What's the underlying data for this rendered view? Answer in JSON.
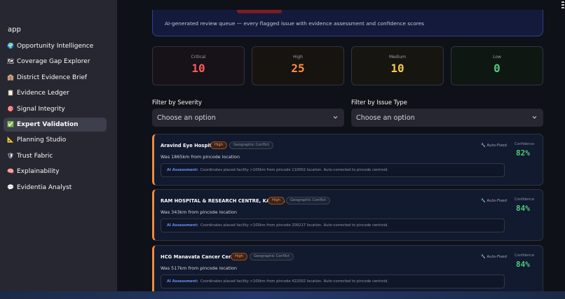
{
  "sidebar": {
    "app_label": "app",
    "items": [
      {
        "emoji": "🌍",
        "label": "Opportunity Intelligence",
        "active": false
      },
      {
        "emoji": "🗺",
        "label": "Coverage Gap Explorer",
        "active": false
      },
      {
        "emoji": "🏨",
        "label": "District Evidence Brief",
        "active": false
      },
      {
        "emoji": "📋",
        "label": "Evidence Ledger",
        "active": false
      },
      {
        "emoji": "🎯",
        "label": "Signal Integrity",
        "active": false
      },
      {
        "emoji": "✅",
        "label": "Expert Validation",
        "active": true
      },
      {
        "emoji": "📐",
        "label": "Planning Studio",
        "active": false
      },
      {
        "emoji": "🛡",
        "label": "Trust Fabric",
        "active": false
      },
      {
        "emoji": "🧠",
        "label": "Explainability",
        "active": false
      },
      {
        "emoji": "💬",
        "label": "Evidentia Analyst",
        "active": false
      }
    ]
  },
  "banner": {
    "text": "AI-generated review queue — every flagged issue with evidence assessment and confidence scores"
  },
  "metrics": [
    {
      "label": "Critical",
      "value": "10",
      "color": "#ff5a5a"
    },
    {
      "label": "High",
      "value": "25",
      "color": "#ff8c42"
    },
    {
      "label": "Medium",
      "value": "10",
      "color": "#f2c94c"
    },
    {
      "label": "Low",
      "value": "0",
      "color": "#4ec97a"
    }
  ],
  "filters": {
    "severity": {
      "label": "Filter by Severity",
      "placeholder": "Choose an option"
    },
    "issue_type": {
      "label": "Filter by Issue Type",
      "placeholder": "Choose an option"
    }
  },
  "issues": [
    {
      "title": "Aravind Eye Hospital",
      "severity": "High",
      "type": "Geographic Conflict",
      "description": "Was 1865km from pincode location",
      "auto_fixed": "Auto-Fixed",
      "confidence_label": "Confidence",
      "confidence": "82%",
      "assessment_key": "AI Assessment:",
      "assessment": "Coordinates placed facility >100km from pincode 110002 location. Auto-corrected to pincode centroid."
    },
    {
      "title": "RAM HOSPITAL & RESEARCH CENTRE, KANPUR",
      "severity": "High",
      "type": "Geographic Conflict",
      "description": "Was 343km from pincode location",
      "auto_fixed": "Auto-Fixed",
      "confidence_label": "Confidence",
      "confidence": "84%",
      "assessment_key": "AI Assessment:",
      "assessment": "Coordinates placed facility >100km from pincode 209217 location. Auto-corrected to pincode centroid."
    },
    {
      "title": "HCG Manavata Cancer Centre",
      "severity": "High",
      "type": "Geographic Conflict",
      "description": "Was 517km from pincode location",
      "auto_fixed": "Auto-Fixed",
      "confidence_label": "Confidence",
      "confidence": "84%",
      "assessment_key": "AI Assessment:",
      "assessment": "Coordinates placed facility >100km from pincode 422002 location. Auto-corrected to pincode centroid."
    }
  ]
}
